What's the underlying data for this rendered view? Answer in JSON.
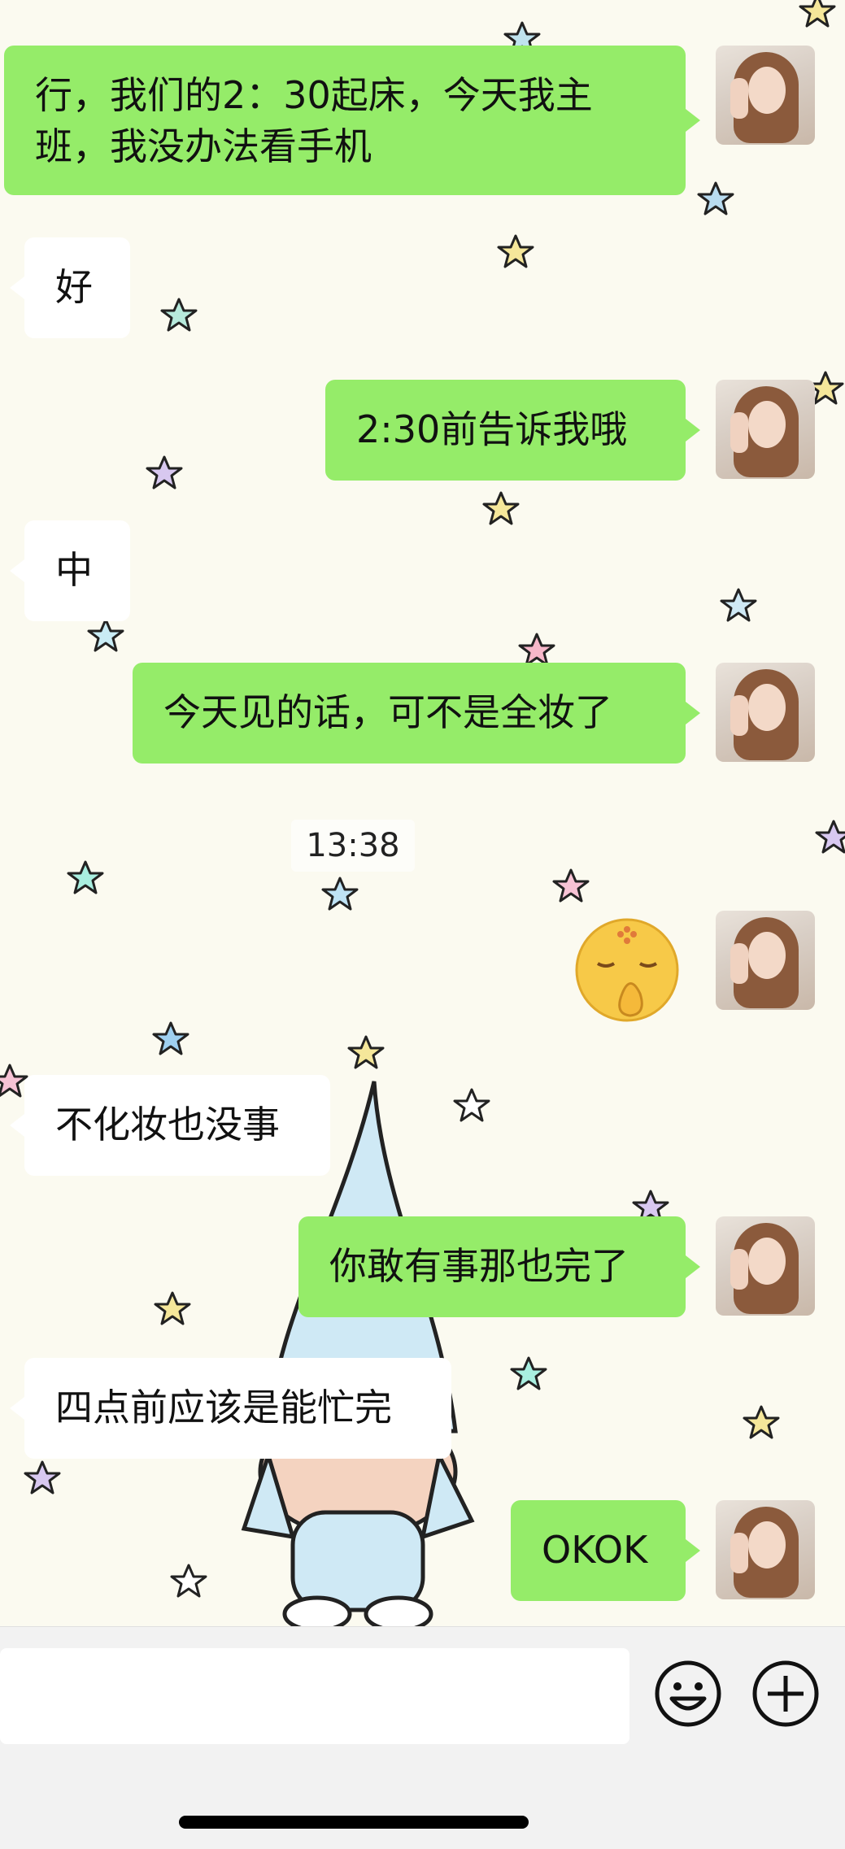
{
  "messages": [
    {
      "side": "out",
      "text": "行，我们的2：30起床，今天我主班，我没办法看手机"
    },
    {
      "side": "in",
      "text": "好"
    },
    {
      "side": "out",
      "text": "2:30前告诉我哦"
    },
    {
      "side": "in",
      "text": "中"
    },
    {
      "side": "out",
      "text": "今天见的话，可不是全妆了"
    },
    {
      "side": "out",
      "type": "sticker",
      "icon": "praying-emoji-sticker"
    },
    {
      "side": "in",
      "text": "不化妆也没事"
    },
    {
      "side": "out",
      "text": "你敢有事那也完了"
    },
    {
      "side": "in",
      "text": "四点前应该是能忙完"
    },
    {
      "side": "out",
      "text": "OKOK"
    }
  ],
  "timestamp": "13:38",
  "input_bar": {
    "emoji_icon": "smiley-face-icon",
    "plus_icon": "plus-circle-icon"
  },
  "colors": {
    "outgoing_bubble": "#95ec69",
    "incoming_bubble": "#ffffff",
    "background": "#fbfaf0"
  }
}
